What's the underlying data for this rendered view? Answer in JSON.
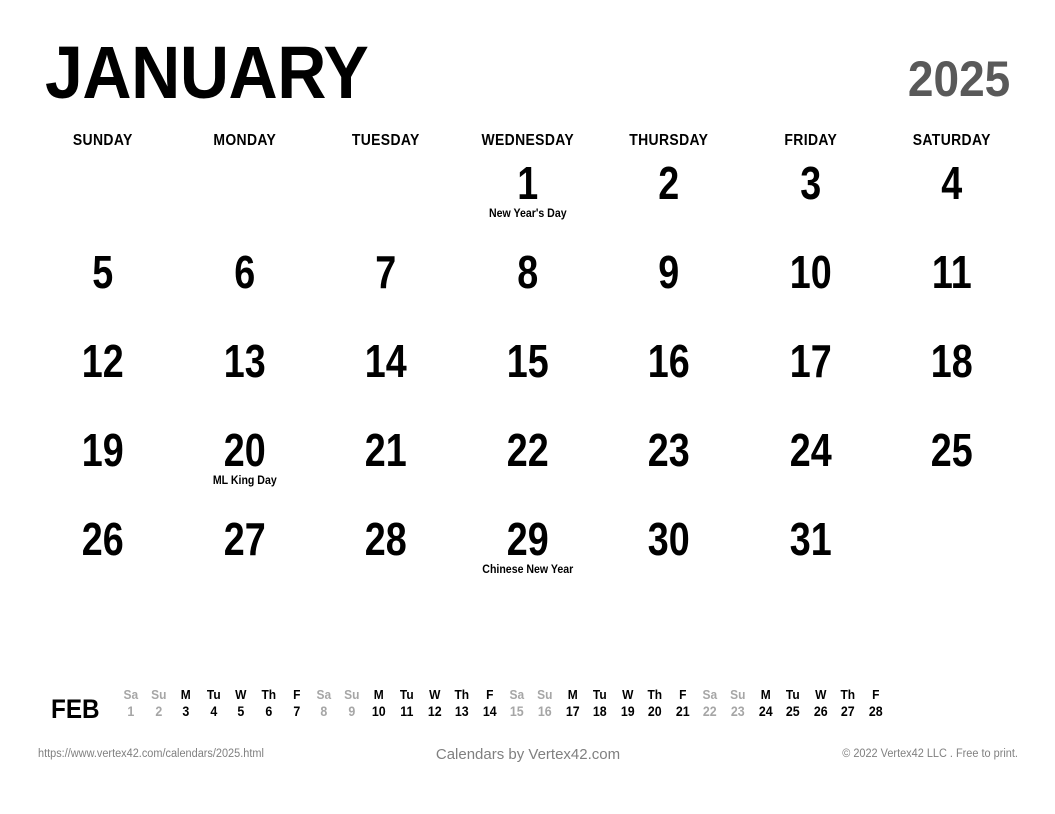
{
  "header": {
    "month": "JANUARY",
    "year": "2025",
    "year_color": "#595959"
  },
  "weekdays": [
    "SUNDAY",
    "MONDAY",
    "TUESDAY",
    "WEDNESDAY",
    "THURSDAY",
    "FRIDAY",
    "SATURDAY"
  ],
  "grid": {
    "rows": 5,
    "columns": 7,
    "cells": [
      {
        "day": "",
        "event": ""
      },
      {
        "day": "",
        "event": ""
      },
      {
        "day": "",
        "event": ""
      },
      {
        "day": "1",
        "event": "New Year's Day"
      },
      {
        "day": "2",
        "event": ""
      },
      {
        "day": "3",
        "event": ""
      },
      {
        "day": "4",
        "event": ""
      },
      {
        "day": "5",
        "event": ""
      },
      {
        "day": "6",
        "event": ""
      },
      {
        "day": "7",
        "event": ""
      },
      {
        "day": "8",
        "event": ""
      },
      {
        "day": "9",
        "event": ""
      },
      {
        "day": "10",
        "event": ""
      },
      {
        "day": "11",
        "event": ""
      },
      {
        "day": "12",
        "event": ""
      },
      {
        "day": "13",
        "event": ""
      },
      {
        "day": "14",
        "event": ""
      },
      {
        "day": "15",
        "event": ""
      },
      {
        "day": "16",
        "event": ""
      },
      {
        "day": "17",
        "event": ""
      },
      {
        "day": "18",
        "event": ""
      },
      {
        "day": "19",
        "event": ""
      },
      {
        "day": "20",
        "event": "ML King Day"
      },
      {
        "day": "21",
        "event": ""
      },
      {
        "day": "22",
        "event": ""
      },
      {
        "day": "23",
        "event": ""
      },
      {
        "day": "24",
        "event": ""
      },
      {
        "day": "25",
        "event": ""
      },
      {
        "day": "26",
        "event": ""
      },
      {
        "day": "27",
        "event": ""
      },
      {
        "day": "28",
        "event": ""
      },
      {
        "day": "29",
        "event": "Chinese New Year"
      },
      {
        "day": "30",
        "event": ""
      },
      {
        "day": "31",
        "event": ""
      },
      {
        "day": "",
        "event": ""
      }
    ]
  },
  "mini_strip": {
    "label": "FEB",
    "weekend_color": "#a6a6a6",
    "weekday_color": "#000000",
    "days": [
      {
        "dow": "Sa",
        "num": "1",
        "weekend": true
      },
      {
        "dow": "Su",
        "num": "2",
        "weekend": true
      },
      {
        "dow": "M",
        "num": "3",
        "weekend": false
      },
      {
        "dow": "Tu",
        "num": "4",
        "weekend": false
      },
      {
        "dow": "W",
        "num": "5",
        "weekend": false
      },
      {
        "dow": "Th",
        "num": "6",
        "weekend": false
      },
      {
        "dow": "F",
        "num": "7",
        "weekend": false
      },
      {
        "dow": "Sa",
        "num": "8",
        "weekend": true
      },
      {
        "dow": "Su",
        "num": "9",
        "weekend": true
      },
      {
        "dow": "M",
        "num": "10",
        "weekend": false
      },
      {
        "dow": "Tu",
        "num": "11",
        "weekend": false
      },
      {
        "dow": "W",
        "num": "12",
        "weekend": false
      },
      {
        "dow": "Th",
        "num": "13",
        "weekend": false
      },
      {
        "dow": "F",
        "num": "14",
        "weekend": false
      },
      {
        "dow": "Sa",
        "num": "15",
        "weekend": true
      },
      {
        "dow": "Su",
        "num": "16",
        "weekend": true
      },
      {
        "dow": "M",
        "num": "17",
        "weekend": false
      },
      {
        "dow": "Tu",
        "num": "18",
        "weekend": false
      },
      {
        "dow": "W",
        "num": "19",
        "weekend": false
      },
      {
        "dow": "Th",
        "num": "20",
        "weekend": false
      },
      {
        "dow": "F",
        "num": "21",
        "weekend": false
      },
      {
        "dow": "Sa",
        "num": "22",
        "weekend": true
      },
      {
        "dow": "Su",
        "num": "23",
        "weekend": true
      },
      {
        "dow": "M",
        "num": "24",
        "weekend": false
      },
      {
        "dow": "Tu",
        "num": "25",
        "weekend": false
      },
      {
        "dow": "W",
        "num": "26",
        "weekend": false
      },
      {
        "dow": "Th",
        "num": "27",
        "weekend": false
      },
      {
        "dow": "F",
        "num": "28",
        "weekend": false
      }
    ]
  },
  "footer": {
    "left": "https://www.vertex42.com/calendars/2025.html",
    "center": "Calendars by Vertex42.com",
    "right": "© 2022 Vertex42 LLC . Free to print."
  }
}
